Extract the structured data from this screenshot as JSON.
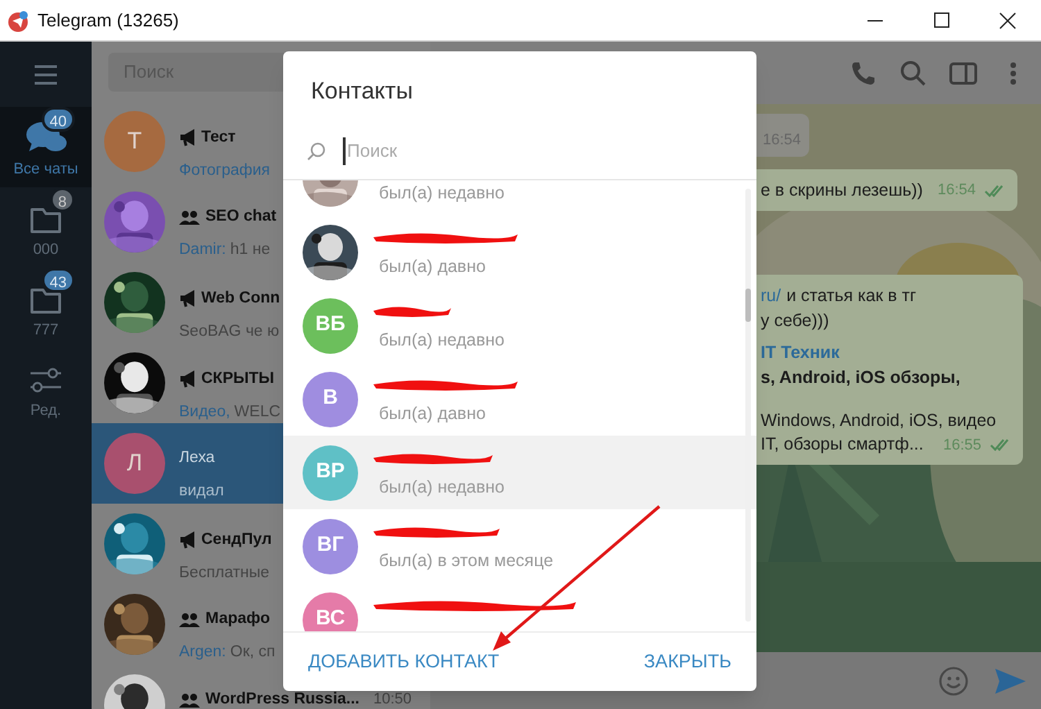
{
  "window": {
    "title": "Telegram (13265)"
  },
  "folders": [
    {
      "kind": "chats",
      "label": "Все чаты",
      "badge": "40",
      "badge_muted": false,
      "selected": true
    },
    {
      "kind": "folder",
      "label": "000",
      "badge": "8",
      "badge_muted": true,
      "selected": false
    },
    {
      "kind": "folder",
      "label": "777",
      "badge": "43",
      "badge_muted": false,
      "selected": false
    },
    {
      "kind": "edit",
      "label": "Ред.",
      "selected": false
    }
  ],
  "chat_list": {
    "search_placeholder": "Поиск",
    "chats": [
      {
        "kind": "channel",
        "title": "Тест",
        "preview_accent": "Фотография",
        "avatar": {
          "kind": "initial",
          "letter": "Т",
          "color": "#a66a40"
        },
        "selected": false
      },
      {
        "kind": "group",
        "title": "SEO chat",
        "preview_accent": "Damir:",
        "preview": "h1 не",
        "selected": false
      },
      {
        "kind": "channel",
        "title": "Web Conn",
        "preview": "SeoBAG че ю",
        "selected": false
      },
      {
        "kind": "channel",
        "title": "СКРЫТЫ",
        "preview_accent": "Видео,",
        "preview": "WELC",
        "selected": false
      },
      {
        "kind": "private",
        "title": "Леха",
        "preview": "видал",
        "avatar": {
          "kind": "initial",
          "letter": "Л",
          "color": "#a9506e"
        },
        "selected": true
      },
      {
        "kind": "channel",
        "title": "СендПул",
        "preview": "Бесплатные",
        "selected": false
      },
      {
        "kind": "group",
        "title": "Марафо",
        "preview_accent": "Argen:",
        "preview": "Ок, сп",
        "selected": false
      },
      {
        "kind": "group",
        "title": "WordPress Russia...",
        "time": "10:50",
        "selected": false
      }
    ]
  },
  "chat": {
    "messages": [
      {
        "kind": "in",
        "time": "16:54"
      },
      {
        "kind": "out",
        "lines": [
          "е в скрины лезешь))"
        ],
        "time": "16:54",
        "read": true
      },
      {
        "kind": "out",
        "link": "ru/",
        "lines": [
          "и статья как в тг",
          "у себе)))"
        ],
        "link_preview": {
          "site": "IT Техник",
          "title": "s, Android, iOS обзоры,",
          "description_lines": [
            "Windows, Android, iOS, видео",
            "IT, обзоры смартф..."
          ]
        },
        "time": "16:55",
        "read": true
      }
    ]
  },
  "dialog": {
    "title": "Контакты",
    "search_placeholder": "Поиск",
    "contacts": [
      {
        "status": "был(а) недавно",
        "name_redacted": false,
        "selected": false
      },
      {
        "status": "был(а) давно",
        "name_redacted": true,
        "selected": false
      },
      {
        "avatar": {
          "kind": "initials",
          "initials": "ВБ",
          "color": "#6cbf5c"
        },
        "status": "был(а) недавно",
        "name_redacted": true,
        "selected": false
      },
      {
        "avatar": {
          "kind": "initials",
          "initials": "В",
          "color": "#9f8de0"
        },
        "status": "был(а) давно",
        "name_redacted": true,
        "selected": false
      },
      {
        "avatar": {
          "kind": "initials",
          "initials": "ВР",
          "color": "#5fc0c6"
        },
        "status": "был(а) недавно",
        "name_redacted": true,
        "selected": true
      },
      {
        "avatar": {
          "kind": "initials",
          "initials": "ВГ",
          "color": "#9d8ee0"
        },
        "status": "был(а) в этом месяце",
        "name_redacted": true,
        "selected": false
      },
      {
        "avatar": {
          "kind": "initials",
          "initials": "ВС",
          "color": "#e57ba8"
        },
        "name_redacted": true,
        "selected": false
      }
    ],
    "buttons": [
      {
        "label": "ДОБАВИТЬ КОНТАКТ"
      },
      {
        "label": "ЗАКРЫТЬ"
      }
    ]
  }
}
